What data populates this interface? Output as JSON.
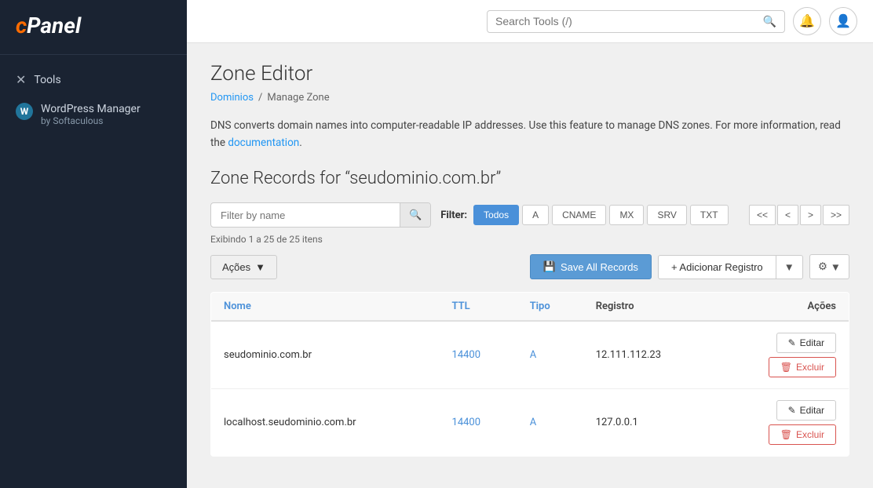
{
  "sidebar": {
    "logo": "cPanel",
    "logo_c": "c",
    "logo_rest": "Panel",
    "items": [
      {
        "id": "tools",
        "label": "Tools",
        "icon": "✕"
      },
      {
        "id": "wordpress",
        "label": "WordPress Manager",
        "sub": "by Softaculous",
        "icon": "W"
      }
    ]
  },
  "header": {
    "search_placeholder": "Search Tools (/)",
    "search_value": ""
  },
  "page": {
    "title": "Zone Editor",
    "breadcrumb": [
      {
        "label": "Dominios",
        "href": "#"
      },
      {
        "label": "Manage Zone"
      }
    ],
    "description_before": "DNS converts domain names into computer-readable IP addresses. Use this feature to manage DNS zones. For more information, read the ",
    "description_link": "documentation",
    "description_after": ".",
    "zone_records_title": "Zone Records for “seudominio.com.br”",
    "filter_placeholder": "Filter by name",
    "filter_label": "Filter:",
    "filter_buttons": [
      {
        "label": "Todos",
        "active": true
      },
      {
        "label": "A",
        "active": false
      },
      {
        "label": "CNAME",
        "active": false
      },
      {
        "label": "MX",
        "active": false
      },
      {
        "label": "SRV",
        "active": false
      },
      {
        "label": "TXT",
        "active": false
      }
    ],
    "pagination": {
      "first": "<<",
      "prev": "<",
      "next": ">",
      "last": ">>",
      "info": "Exibindo 1 a 25 de 25 itens"
    },
    "buttons": {
      "acoes": "Ações",
      "save_all": "Save All Records",
      "adicionar": "+ Adicionar Registro"
    },
    "table": {
      "columns": [
        "Nome",
        "TTL",
        "Tipo",
        "Registro",
        "Ações"
      ],
      "rows": [
        {
          "nome": "seudominio.com.br",
          "ttl": "14400",
          "tipo": "A",
          "registro": "12.111.112.23",
          "edit_label": "Editar",
          "del_label": "Excluir"
        },
        {
          "nome": "localhost.seudominio.com.br",
          "ttl": "14400",
          "tipo": "A",
          "registro": "127.0.0.1",
          "edit_label": "Editar",
          "del_label": "Excluir"
        }
      ]
    }
  }
}
